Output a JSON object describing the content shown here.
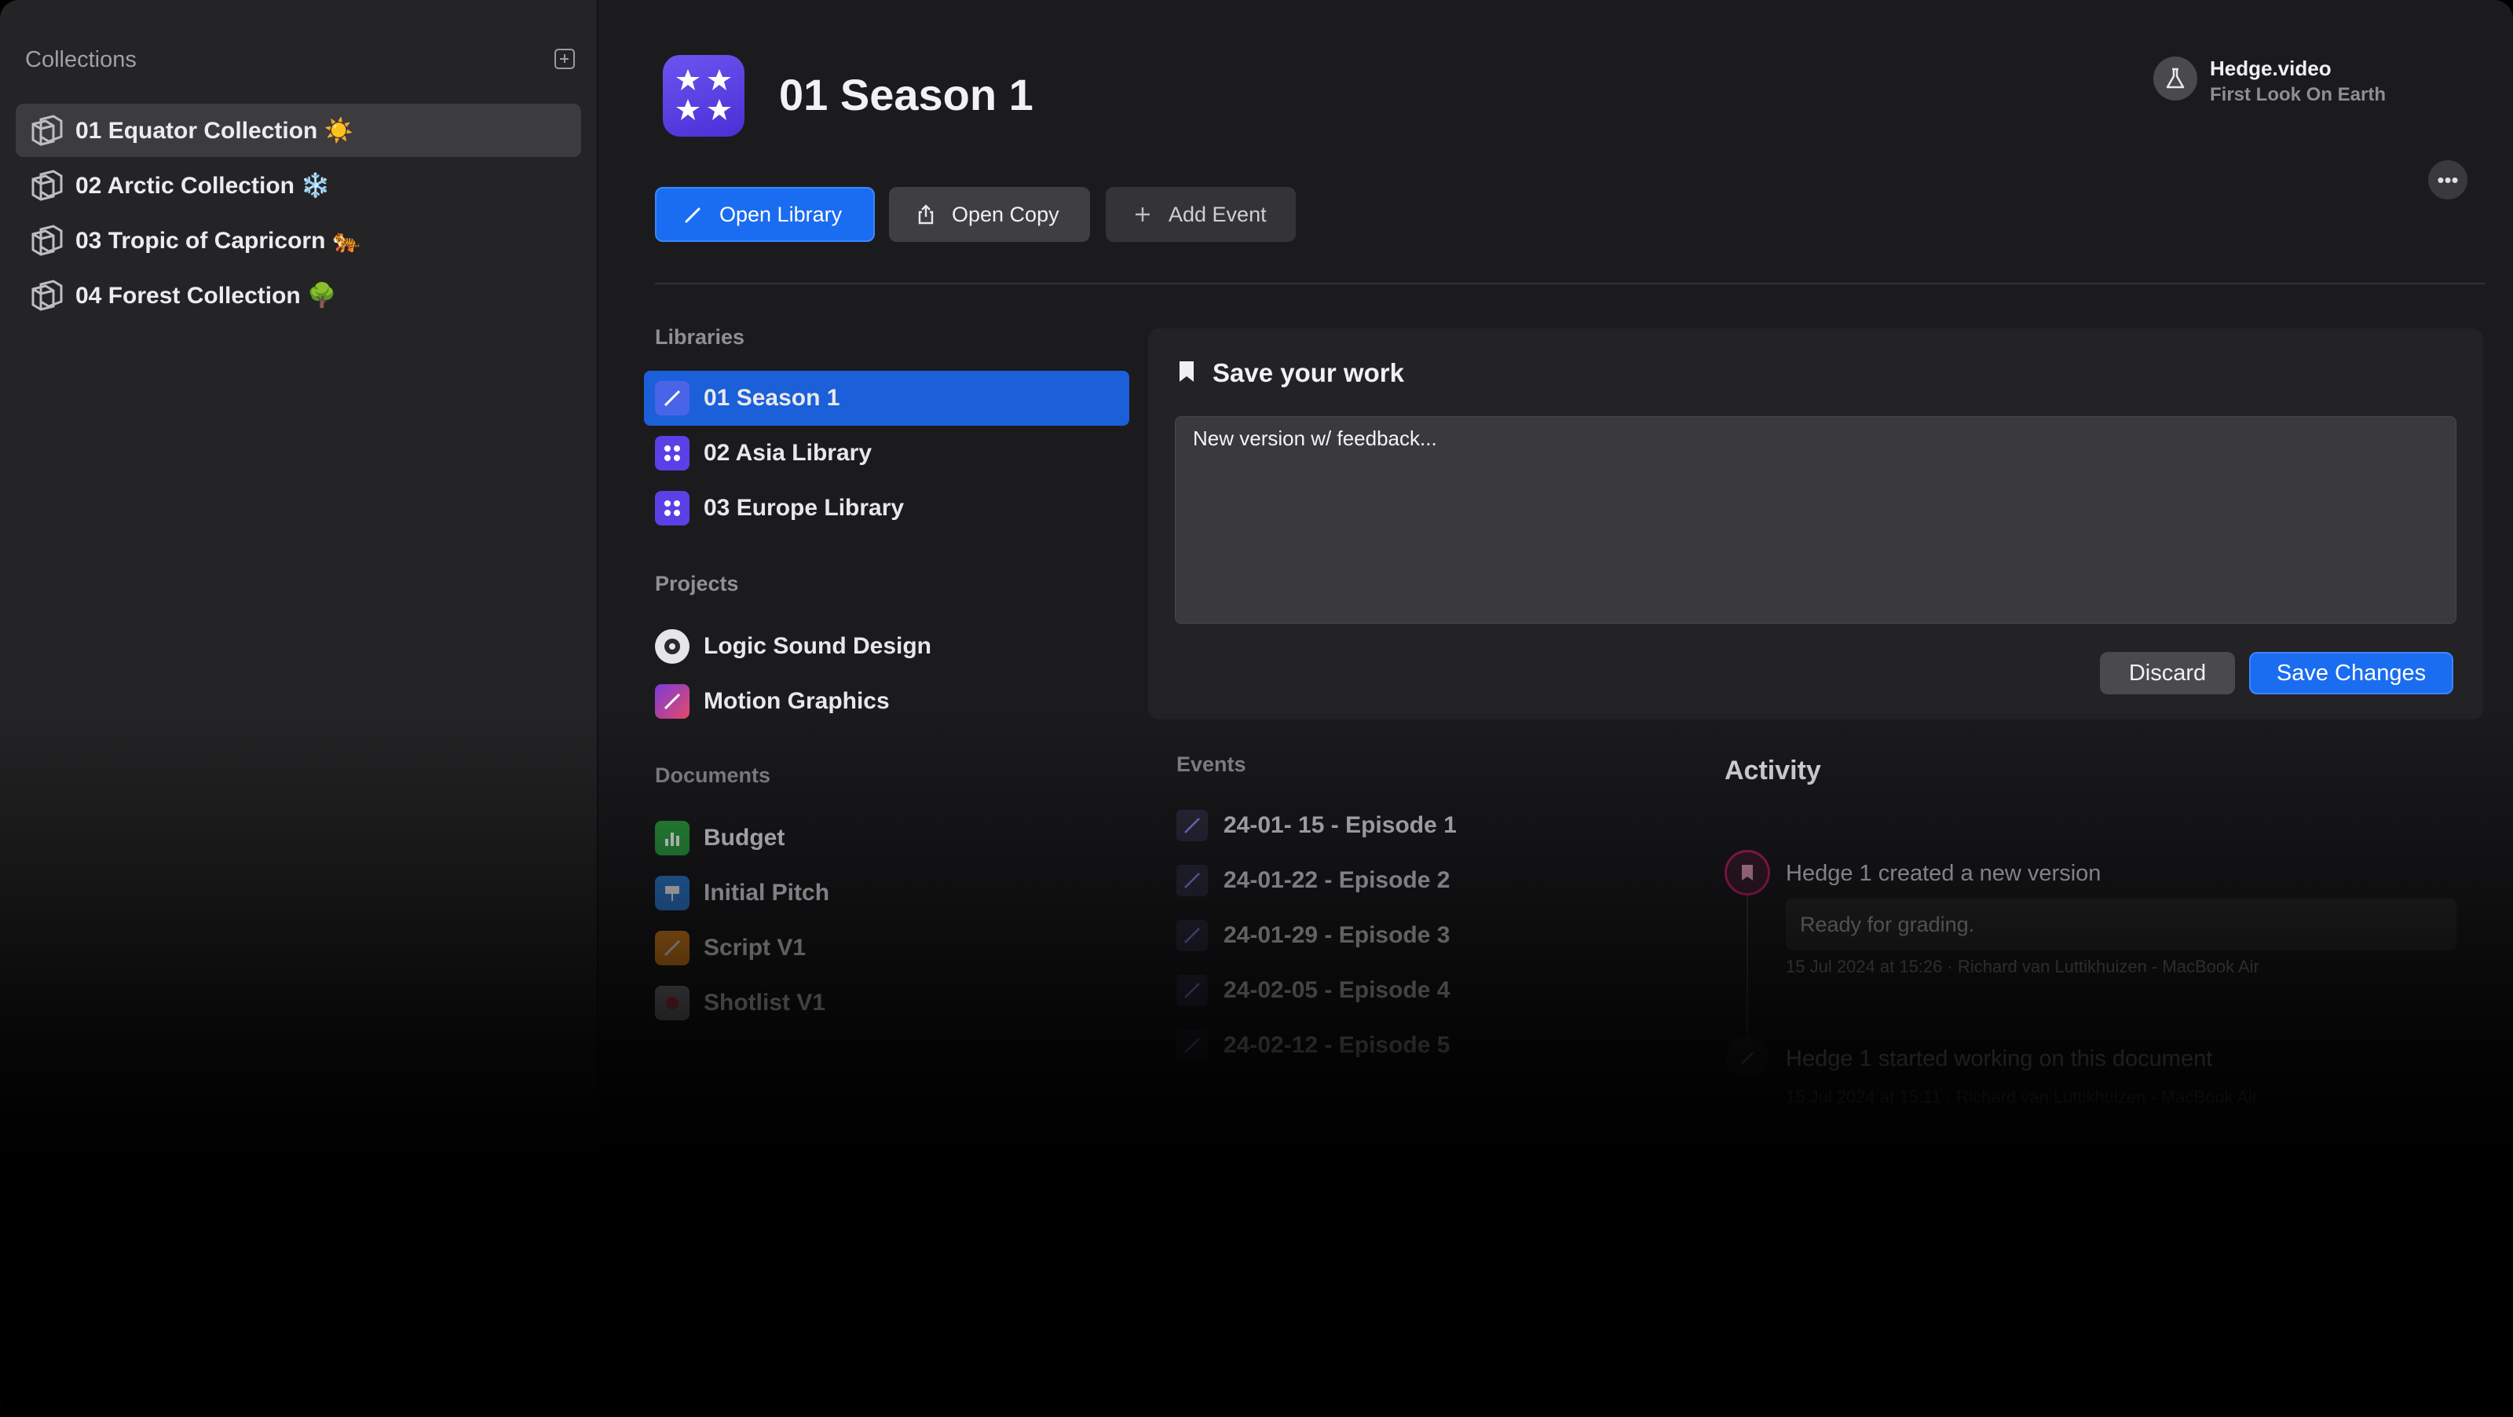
{
  "sidebar": {
    "header": "Collections",
    "items": [
      {
        "label": "01 Equator Collection ☀️",
        "active": true
      },
      {
        "label": "02 Arctic Collection ❄️",
        "active": false
      },
      {
        "label": "03 Tropic of Capricorn 🐅",
        "active": false
      },
      {
        "label": "04 Forest Collection 🌳",
        "active": false
      }
    ]
  },
  "header": {
    "title": "01 Season 1",
    "user_name": "Hedge.video",
    "user_subtitle": "First Look On Earth"
  },
  "toolbar": {
    "open_library": "Open Library",
    "open_copy": "Open Copy",
    "add_event": "Add Event"
  },
  "libraries": {
    "heading": "Libraries",
    "items": [
      "01 Season 1",
      "02 Asia Library",
      "03 Europe Library"
    ]
  },
  "projects": {
    "heading": "Projects",
    "items": [
      "Logic Sound Design",
      "Motion Graphics"
    ]
  },
  "documents": {
    "heading": "Documents",
    "items": [
      "Budget",
      "Initial Pitch",
      "Script V1",
      "Shotlist V1"
    ]
  },
  "save_panel": {
    "title": "Save your work",
    "note_value": "New version w/ feedback...",
    "discard": "Discard",
    "save": "Save Changes"
  },
  "events": {
    "heading": "Events",
    "items": [
      "24-01- 15 - Episode 1",
      "24-01-22 - Episode 2",
      "24-01-29 - Episode 3",
      "24-02-05 - Episode 4",
      "24-02-12 - Episode 5"
    ]
  },
  "activity": {
    "heading": "Activity",
    "items": [
      {
        "text": "Hedge 1 created a new version",
        "note": "Ready for grading.",
        "meta": "15 Jul 2024 at 15:26 · Richard van Luttikhuizen - MacBook Air"
      },
      {
        "text": "Hedge 1 started working on this document",
        "meta": "15 Jul 2024 at 15:11 · Richard van Luttikhuizen - MacBook Air"
      }
    ]
  },
  "colors": {
    "accent": "#1a6cf0",
    "library_icon": "#5a40e6",
    "activity_marker": "#c0206a"
  }
}
